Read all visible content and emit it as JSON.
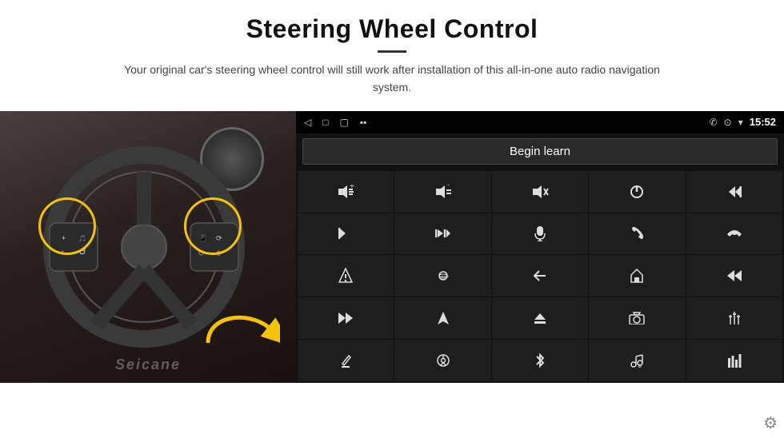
{
  "header": {
    "title": "Steering Wheel Control",
    "divider": true,
    "subtitle": "Your original car's steering wheel control will still work after installation of this all-in-one auto radio navigation system."
  },
  "headunit": {
    "status_bar": {
      "back_icon": "◁",
      "home_icon": "□",
      "recents_icon": "▢",
      "battery_icon": "▪▪",
      "phone_icon": "✆",
      "location_icon": "⊙",
      "wifi_icon": "▾",
      "time": "15:52"
    },
    "begin_learn_label": "Begin learn",
    "controls": [
      {
        "icon": "🔊+",
        "label": "vol-up"
      },
      {
        "icon": "🔊-",
        "label": "vol-down"
      },
      {
        "icon": "🔇",
        "label": "mute"
      },
      {
        "icon": "⏻",
        "label": "power"
      },
      {
        "icon": "⏮",
        "label": "prev-track"
      },
      {
        "icon": "⏭",
        "label": "next"
      },
      {
        "icon": "✂⏭",
        "label": "next-alt"
      },
      {
        "icon": "🎤",
        "label": "mic"
      },
      {
        "icon": "✆",
        "label": "phone"
      },
      {
        "icon": "↩",
        "label": "hang-up"
      },
      {
        "icon": "🔔",
        "label": "alert"
      },
      {
        "icon": "360°",
        "label": "camera-360"
      },
      {
        "icon": "↩",
        "label": "back"
      },
      {
        "icon": "⌂",
        "label": "home"
      },
      {
        "icon": "⏮⏮",
        "label": "rewind"
      },
      {
        "icon": "⏭⏭",
        "label": "fast-forward"
      },
      {
        "icon": "▶",
        "label": "navigate"
      },
      {
        "icon": "⏺",
        "label": "eject"
      },
      {
        "icon": "📷",
        "label": "camera"
      },
      {
        "icon": "⚙",
        "label": "settings-eq"
      },
      {
        "icon": "✏",
        "label": "edit"
      },
      {
        "icon": "⊙",
        "label": "steering"
      },
      {
        "icon": "✱",
        "label": "bluetooth"
      },
      {
        "icon": "♪⚙",
        "label": "music-settings"
      },
      {
        "icon": "▐▐",
        "label": "equalizer"
      }
    ],
    "seicane_watermark": "Seicane",
    "gear_icon": "⚙"
  }
}
